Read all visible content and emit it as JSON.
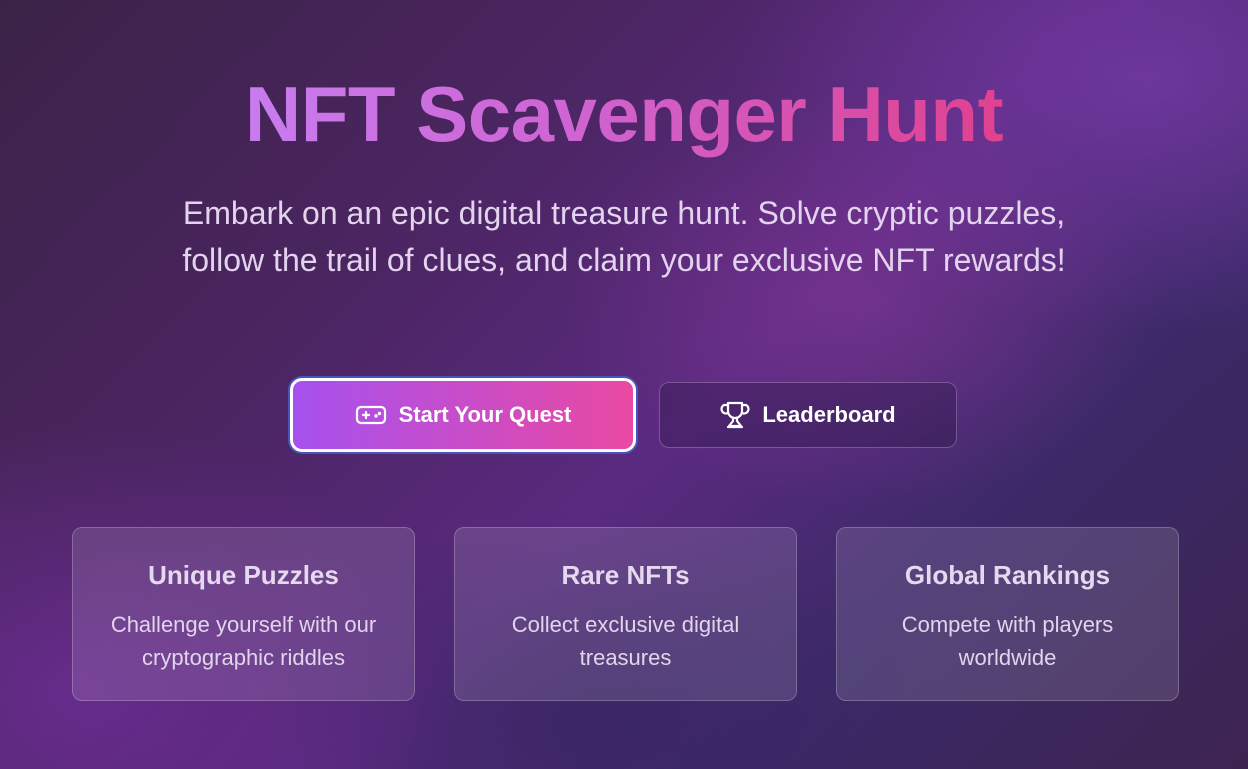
{
  "hero": {
    "title": "NFT Scavenger Hunt",
    "subtitle": "Embark on an epic digital treasure hunt. Solve cryptic puzzles, follow the trail of clues, and claim your exclusive NFT rewards!"
  },
  "actions": {
    "primary": {
      "label": "Start Your Quest",
      "icon": "gamepad-icon"
    },
    "secondary": {
      "label": "Leaderboard",
      "icon": "trophy-icon"
    }
  },
  "features": [
    {
      "title": "Unique Puzzles",
      "description": "Challenge yourself with our cryptographic riddles"
    },
    {
      "title": "Rare NFTs",
      "description": "Collect exclusive digital treasures"
    },
    {
      "title": "Global Rankings",
      "description": "Compete with players worldwide"
    }
  ],
  "colors": {
    "gradient_start": "#a651ef",
    "gradient_end": "#e949a2",
    "title_start": "#c87cef",
    "title_end": "#e0418f"
  }
}
